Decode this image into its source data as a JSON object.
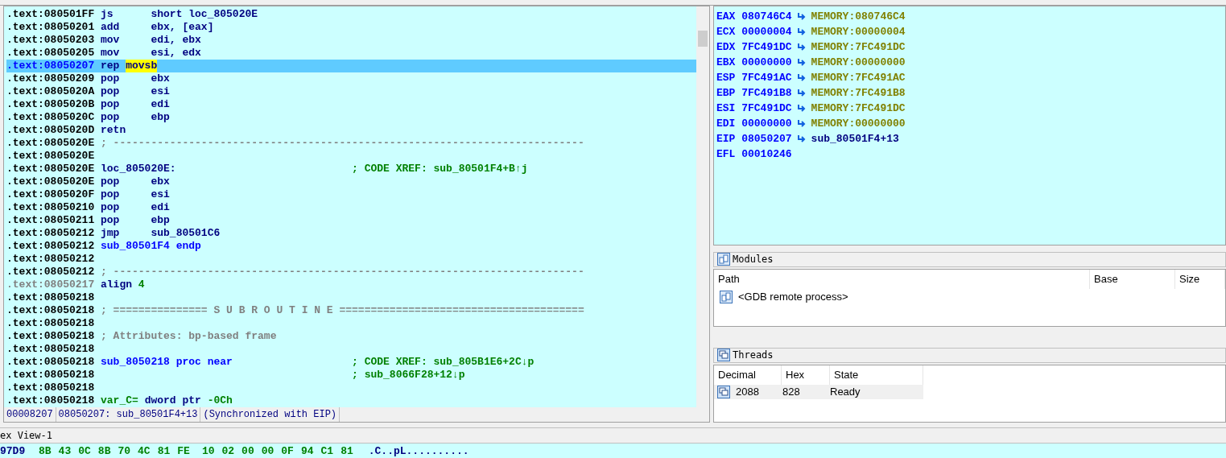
{
  "disassembly": {
    "lines": [
      {
        "address": ".text:080501FF",
        "dim": false,
        "selected": false,
        "parts": [
          {
            "kind": "mnem",
            "text": "js"
          },
          {
            "kind": "op",
            "text": "short loc_805020E"
          }
        ]
      },
      {
        "address": ".text:08050201",
        "dim": false,
        "selected": false,
        "parts": [
          {
            "kind": "mnem",
            "text": "add"
          },
          {
            "kind": "op",
            "text": "ebx, [eax]"
          }
        ]
      },
      {
        "address": ".text:08050203",
        "dim": false,
        "selected": false,
        "parts": [
          {
            "kind": "mnem",
            "text": "mov"
          },
          {
            "kind": "op",
            "text": "edi, ebx"
          }
        ]
      },
      {
        "address": ".text:08050205",
        "dim": false,
        "selected": false,
        "parts": [
          {
            "kind": "mnem",
            "text": "mov"
          },
          {
            "kind": "op",
            "text": "esi, edx"
          }
        ]
      },
      {
        "address": ".text:08050207",
        "dim": false,
        "selected": true,
        "parts": [
          {
            "kind": "op",
            "text": "rep"
          },
          {
            "kind": "highlight",
            "text": "movsb"
          }
        ]
      },
      {
        "address": ".text:08050209",
        "dim": false,
        "selected": false,
        "parts": [
          {
            "kind": "mnem",
            "text": "pop"
          },
          {
            "kind": "op",
            "text": "ebx"
          }
        ]
      },
      {
        "address": ".text:0805020A",
        "dim": false,
        "selected": false,
        "parts": [
          {
            "kind": "mnem",
            "text": "pop"
          },
          {
            "kind": "op",
            "text": "esi"
          }
        ]
      },
      {
        "address": ".text:0805020B",
        "dim": false,
        "selected": false,
        "parts": [
          {
            "kind": "mnem",
            "text": "pop"
          },
          {
            "kind": "op",
            "text": "edi"
          }
        ]
      },
      {
        "address": ".text:0805020C",
        "dim": false,
        "selected": false,
        "parts": [
          {
            "kind": "mnem",
            "text": "pop"
          },
          {
            "kind": "op",
            "text": "ebp"
          }
        ]
      },
      {
        "address": ".text:0805020D",
        "dim": false,
        "selected": false,
        "parts": [
          {
            "kind": "op",
            "text": "retn"
          }
        ]
      },
      {
        "address": ".text:0805020E",
        "dim": false,
        "selected": false,
        "parts": [
          {
            "kind": "comment",
            "text": "; ---------------------------------------------------------------------------"
          }
        ]
      },
      {
        "address": ".text:0805020E",
        "dim": false,
        "selected": false
      },
      {
        "address": ".text:0805020E",
        "dim": false,
        "selected": false,
        "parts": [
          {
            "kind": "op",
            "text": "loc_805020E:"
          },
          {
            "kind": "xref",
            "text": "; CODE XREF: sub_80501F4+B↑j"
          }
        ]
      },
      {
        "address": ".text:0805020E",
        "dim": false,
        "selected": false,
        "parts": [
          {
            "kind": "mnem",
            "text": "pop"
          },
          {
            "kind": "op",
            "text": "ebx"
          }
        ]
      },
      {
        "address": ".text:0805020F",
        "dim": false,
        "selected": false,
        "parts": [
          {
            "kind": "mnem",
            "text": "pop"
          },
          {
            "kind": "op",
            "text": "esi"
          }
        ]
      },
      {
        "address": ".text:08050210",
        "dim": false,
        "selected": false,
        "parts": [
          {
            "kind": "mnem",
            "text": "pop"
          },
          {
            "kind": "op",
            "text": "edi"
          }
        ]
      },
      {
        "address": ".text:08050211",
        "dim": false,
        "selected": false,
        "parts": [
          {
            "kind": "mnem",
            "text": "pop"
          },
          {
            "kind": "op",
            "text": "ebp"
          }
        ]
      },
      {
        "address": ".text:08050212",
        "dim": false,
        "selected": false,
        "parts": [
          {
            "kind": "mnem",
            "text": "jmp"
          },
          {
            "kind": "op",
            "text": "sub_80501C6"
          }
        ]
      },
      {
        "address": ".text:08050212",
        "dim": false,
        "selected": false,
        "parts": [
          {
            "kind": "name",
            "text": "sub_80501F4 endp"
          }
        ]
      },
      {
        "address": ".text:08050212",
        "dim": false,
        "selected": false
      },
      {
        "address": ".text:08050212",
        "dim": false,
        "selected": false,
        "parts": [
          {
            "kind": "comment",
            "text": "; ---------------------------------------------------------------------------"
          }
        ]
      },
      {
        "address": ".text:08050217",
        "dim": true,
        "selected": false,
        "parts": [
          {
            "kind": "op",
            "text": "align"
          },
          {
            "kind": "num",
            "text": "4"
          }
        ]
      },
      {
        "address": ".text:08050218",
        "dim": false,
        "selected": false
      },
      {
        "address": ".text:08050218",
        "dim": false,
        "selected": false,
        "parts": [
          {
            "kind": "comment",
            "text": "; =============== S U B R O U T I N E ======================================="
          }
        ]
      },
      {
        "address": ".text:08050218",
        "dim": false,
        "selected": false
      },
      {
        "address": ".text:08050218",
        "dim": false,
        "selected": false,
        "parts": [
          {
            "kind": "comment",
            "text": "; Attributes: bp-based frame"
          }
        ]
      },
      {
        "address": ".text:08050218",
        "dim": false,
        "selected": false
      },
      {
        "address": ".text:08050218",
        "dim": false,
        "selected": false,
        "parts": [
          {
            "kind": "name",
            "text": "sub_8050218 proc near"
          },
          {
            "kind": "xref",
            "text": "; CODE XREF: sub_805B1E6+2C↓p"
          }
        ]
      },
      {
        "address": ".text:08050218",
        "dim": false,
        "selected": false,
        "parts": [
          {
            "kind": "xref",
            "text": "; sub_8066F28+12↓p"
          }
        ]
      },
      {
        "address": ".text:08050218",
        "dim": false,
        "selected": false
      },
      {
        "address": ".text:08050218",
        "dim": false,
        "selected": false,
        "parts": [
          {
            "kind": "num",
            "text": "var_C="
          },
          {
            "kind": "op",
            "text": "dword ptr"
          },
          {
            "kind": "num",
            "text": "-0Ch"
          }
        ]
      }
    ],
    "status_bar": [
      "00008207",
      "08050207: sub_80501F4+13",
      "(Synchronized with EIP)"
    ]
  },
  "registers": [
    {
      "name": "EAX",
      "value": "080746C4",
      "kind": "memory",
      "target": "MEMORY:080746C4"
    },
    {
      "name": "ECX",
      "value": "00000004",
      "kind": "memory",
      "target": "MEMORY:00000004"
    },
    {
      "name": "EDX",
      "value": "7FC491DC",
      "kind": "memory",
      "target": "MEMORY:7FC491DC"
    },
    {
      "name": "EBX",
      "value": "00000000",
      "kind": "memory",
      "target": "MEMORY:00000000"
    },
    {
      "name": "ESP",
      "value": "7FC491AC",
      "kind": "memory",
      "target": "MEMORY:7FC491AC"
    },
    {
      "name": "EBP",
      "value": "7FC491B8",
      "kind": "memory",
      "target": "MEMORY:7FC491B8"
    },
    {
      "name": "ESI",
      "value": "7FC491DC",
      "kind": "memory",
      "target": "MEMORY:7FC491DC"
    },
    {
      "name": "EDI",
      "value": "00000000",
      "kind": "memory",
      "target": "MEMORY:00000000"
    },
    {
      "name": "EIP",
      "value": "08050207",
      "kind": "code",
      "target": "sub_80501F4+13"
    },
    {
      "name": "EFL",
      "value": "00010246",
      "kind": "plain"
    }
  ],
  "modules": {
    "title": "Modules",
    "columns": [
      "Path",
      "Base",
      "Size"
    ],
    "rows": [
      {
        "path": "<GDB remote process>"
      }
    ]
  },
  "threads": {
    "title": "Threads",
    "columns": [
      "Decimal",
      "Hex",
      "State"
    ],
    "rows": [
      {
        "decimal": "2088",
        "hex": "828",
        "state": "Ready",
        "selected": true
      }
    ]
  },
  "hex_view": {
    "title": "ex View-1",
    "address": "97D9",
    "bytes": [
      "8B",
      "43",
      "0C",
      "8B",
      "70",
      "4C",
      "81",
      "FE",
      "10",
      "02",
      "00",
      "00",
      "0F",
      "94",
      "C1",
      "81"
    ],
    "ascii": ".C..pL.........."
  }
}
